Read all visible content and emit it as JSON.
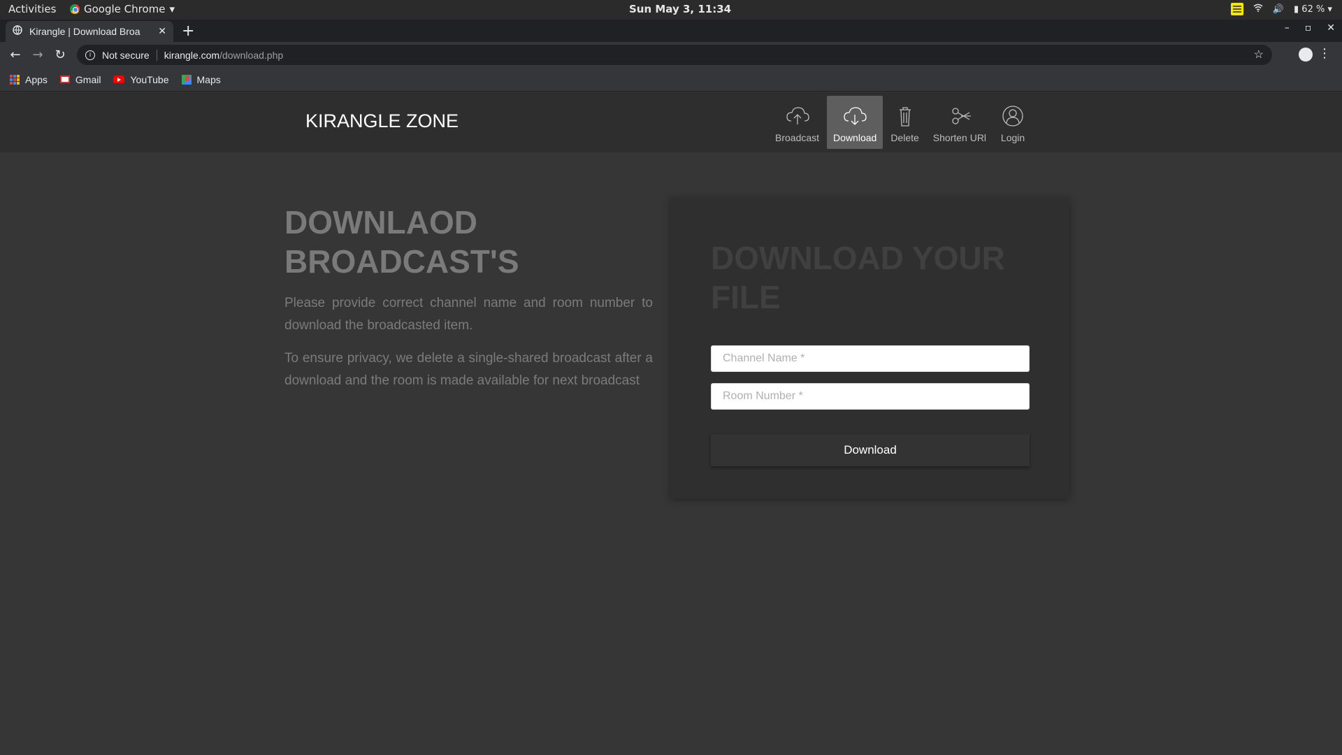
{
  "system_bar": {
    "activities": "Activities",
    "app_name": "Google Chrome",
    "clock": "Sun May  3, 11:34",
    "battery": "62 %"
  },
  "browser": {
    "tab_title": "Kirangle | Download Broa",
    "security": "Not secure",
    "url_host": "kirangle.com",
    "url_path": "/download.php",
    "bookmarks": [
      {
        "label": "Apps",
        "icon": "apps-icon"
      },
      {
        "label": "Gmail",
        "icon": "gmail-icon"
      },
      {
        "label": "YouTube",
        "icon": "youtube-icon"
      },
      {
        "label": "Maps",
        "icon": "maps-icon"
      }
    ]
  },
  "site": {
    "brand": "KIRANGLE ZONE",
    "nav": [
      {
        "label": "Broadcast",
        "icon": "cloud-upload-icon"
      },
      {
        "label": "Download",
        "icon": "cloud-download-icon",
        "active": true
      },
      {
        "label": "Delete",
        "icon": "trash-icon"
      },
      {
        "label": "Shorten URl",
        "icon": "scissors-icon"
      },
      {
        "label": "Login",
        "icon": "user-icon"
      }
    ]
  },
  "main": {
    "title": "DOWNLAOD BROADCAST'S",
    "paragraph1": "Please provide correct channel name and room number to download the broadcasted item.",
    "paragraph2": "To ensure privacy, we delete a single-shared broadcast after a download and the room is made available for next broadcast"
  },
  "form": {
    "title": "DOWNLOAD YOUR FILE",
    "channel_placeholder": "Channel Name *",
    "room_placeholder": "Room Number *",
    "submit_label": "Download"
  },
  "colors": {
    "page_bg": "#363636",
    "header_bg": "#2e2e2e",
    "active_nav_bg": "#5e5e5e",
    "card_bg": "#2f2f2f"
  }
}
